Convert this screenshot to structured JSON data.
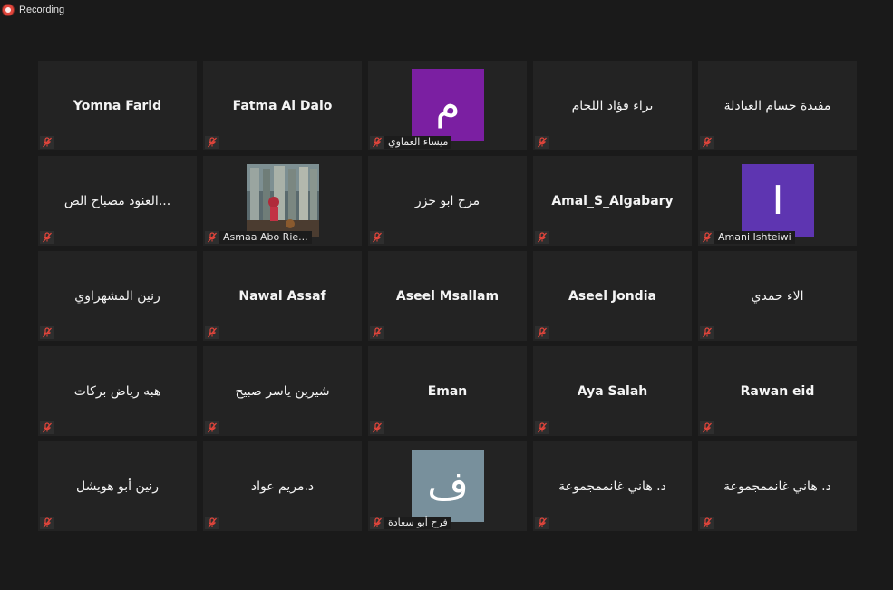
{
  "recording": {
    "label": "Recording"
  },
  "colors": {
    "background": "#1a1a1a",
    "tile": "#232323",
    "muted_icon": "#e0453b",
    "avatar_purple": "#7b1fa2",
    "avatar_indigo": "#5e35b1",
    "avatar_slate": "#78909c"
  },
  "participants": [
    {
      "name": "Yomna Farid",
      "muted": true
    },
    {
      "name": "Fatma Al Dalo",
      "muted": true
    },
    {
      "name": "ميساء العماوي",
      "avatar_letter": "م",
      "avatar_color": "#7b1fa2",
      "muted": true
    },
    {
      "name": "براء فؤاد اللحام",
      "muted": true
    },
    {
      "name": "مفيدة حسام العبادلة",
      "muted": true
    },
    {
      "name": "العنود مصباح الص...",
      "muted": true
    },
    {
      "name": "Asmaa Abo Rie...",
      "photo": true,
      "muted": true
    },
    {
      "name": "مرح ابو جزر",
      "muted": true
    },
    {
      "name": "Amal_S_Algabary",
      "muted": true
    },
    {
      "name": "Amani Ishteiwi",
      "avatar_letter": "I",
      "avatar_color": "#5e35b1",
      "muted": true
    },
    {
      "name": "رنين المشهراوي",
      "muted": true
    },
    {
      "name": "Nawal Assaf",
      "muted": true
    },
    {
      "name": "Aseel Msallam",
      "muted": true
    },
    {
      "name": "Aseel Jondia",
      "muted": true
    },
    {
      "name": "الاء حمدي",
      "muted": true
    },
    {
      "name": "هبه رياض بركات",
      "muted": true
    },
    {
      "name": "شيرين ياسر صبيح",
      "muted": true
    },
    {
      "name": "Eman",
      "muted": true
    },
    {
      "name": "Aya Salah",
      "muted": true
    },
    {
      "name": "Rawan eid",
      "muted": true
    },
    {
      "name": "رنين أبو هويشل",
      "muted": true
    },
    {
      "name": "د.مريم عواد",
      "muted": true
    },
    {
      "name": "فرح أبو سعادة",
      "avatar_letter": "ف",
      "avatar_color": "#78909c",
      "muted": true
    },
    {
      "name": "د. هاني غانممجموعة",
      "muted": true
    },
    {
      "name": "د. هاني غانممجموعة",
      "muted": true
    }
  ]
}
